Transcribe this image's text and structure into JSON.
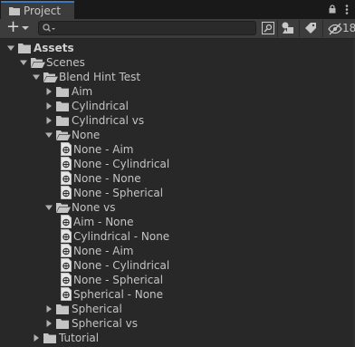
{
  "tab": {
    "title": "Project",
    "lock_icon": "lock-icon",
    "menu_icon": "kebab-menu-icon"
  },
  "toolbar": {
    "search": {
      "value": "",
      "placeholder": ""
    },
    "hidden_packages_count": "18"
  },
  "tree": [
    {
      "label": "Assets",
      "icon": "folder-icon",
      "state": "expanded",
      "bold": true,
      "depth": 0
    },
    {
      "label": "Scenes",
      "icon": "folder-open-icon",
      "state": "expanded",
      "depth": 1
    },
    {
      "label": "Blend Hint Test",
      "icon": "folder-open-icon",
      "state": "expanded",
      "depth": 2
    },
    {
      "label": "Aim",
      "icon": "folder-icon",
      "state": "collapsed",
      "depth": 3
    },
    {
      "label": "Cylindrical",
      "icon": "folder-icon",
      "state": "collapsed",
      "depth": 3
    },
    {
      "label": "Cylindrical vs",
      "icon": "folder-icon",
      "state": "collapsed",
      "depth": 3
    },
    {
      "label": "None",
      "icon": "folder-open-icon",
      "state": "expanded",
      "depth": 3
    },
    {
      "label": "None - Aim",
      "icon": "scene-file-icon",
      "state": "leaf",
      "depth": 4
    },
    {
      "label": "None - Cylindrical",
      "icon": "scene-file-icon",
      "state": "leaf",
      "depth": 4
    },
    {
      "label": "None - None",
      "icon": "scene-file-icon",
      "state": "leaf",
      "depth": 4
    },
    {
      "label": "None - Spherical",
      "icon": "scene-file-icon",
      "state": "leaf",
      "depth": 4
    },
    {
      "label": "None vs",
      "icon": "folder-open-icon",
      "state": "expanded",
      "depth": 3
    },
    {
      "label": "Aim - None",
      "icon": "scene-file-icon",
      "state": "leaf",
      "depth": 4
    },
    {
      "label": "Cylindrical - None",
      "icon": "scene-file-icon",
      "state": "leaf",
      "depth": 4
    },
    {
      "label": "None - Aim",
      "icon": "scene-file-icon",
      "state": "leaf",
      "depth": 4
    },
    {
      "label": "None - Cylindrical",
      "icon": "scene-file-icon",
      "state": "leaf",
      "depth": 4
    },
    {
      "label": "None - Spherical",
      "icon": "scene-file-icon",
      "state": "leaf",
      "depth": 4
    },
    {
      "label": "Spherical - None",
      "icon": "scene-file-icon",
      "state": "leaf",
      "depth": 4
    },
    {
      "label": "Spherical",
      "icon": "folder-icon",
      "state": "collapsed",
      "depth": 3
    },
    {
      "label": "Spherical vs",
      "icon": "folder-icon",
      "state": "collapsed",
      "depth": 3
    },
    {
      "label": "Tutorial",
      "icon": "folder-icon",
      "state": "collapsed",
      "depth": 2
    }
  ],
  "colors": {
    "background": "#282828",
    "toolbar": "#3c3c3c",
    "tab_accent": "#3a79bb",
    "text": "#c4c4c4"
  }
}
